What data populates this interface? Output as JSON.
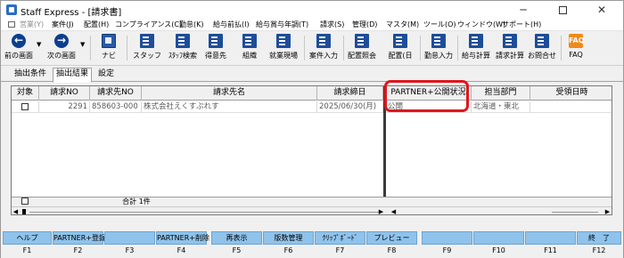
{
  "window": {
    "title": "Staff Express - [請求書]",
    "minimize": "─",
    "close": "✕"
  },
  "menu": [
    {
      "label": "営業(Y)",
      "disabled": true
    },
    {
      "label": "案件(J)"
    },
    {
      "label": "配置(H)"
    },
    {
      "label": "コンプライアンス(C)"
    },
    {
      "label": "勤怠(K)"
    },
    {
      "label": "給与前払(I)"
    },
    {
      "label": "給与賞与年調(T)"
    },
    {
      "label": "請求(S)"
    },
    {
      "label": "管理(D)"
    },
    {
      "label": "マスタ(M)"
    },
    {
      "label": "ツール(O)"
    },
    {
      "label": "ウィンドウ(W)"
    },
    {
      "label": "サポート(H)"
    }
  ],
  "toolbar": {
    "back": "前の画面",
    "forward": "次の画面",
    "navi": "ナビ",
    "staff": "スタッフ",
    "staff_search": "ｽﾀｯﾌ検索",
    "client": "得意先",
    "org": "組織",
    "site": "就業現場",
    "job_entry": "案件入力",
    "assign_view": "配置照会",
    "assign_day": "配置(日",
    "attendance": "勤怠入力",
    "payroll": "給与計算",
    "billing": "請求計算",
    "contact": "お問合せ",
    "faq": "FAQ",
    "faq_icon": "FAQ"
  },
  "tabs": [
    "抽出条件",
    "抽出結果",
    "設定"
  ],
  "grid": {
    "headers": [
      "対象",
      "請求NO",
      "請求先NO",
      "請求先名",
      "請求締日",
      "PARTNER+公開状況",
      "担当部門",
      "受領日時"
    ],
    "rows": [
      {
        "target": "",
        "billing_no": "2291",
        "client_no": "858603-000",
        "client_name": "株式会社えくすぷれす",
        "closing_date": "2025/06/30(月)",
        "partner_status": "公開",
        "dept": "北海道・東北",
        "received": ""
      }
    ],
    "total_label": "合計",
    "total_count": "1件"
  },
  "function_keys": [
    {
      "key": "F1",
      "label": "ヘルプ"
    },
    {
      "key": "F2",
      "label": "PARTNER+登録"
    },
    {
      "key": "F3",
      "label": ""
    },
    {
      "key": "F4",
      "label": "PARTNER+削除"
    },
    {
      "key": "F5",
      "label": "再表示"
    },
    {
      "key": "F6",
      "label": "版数管理"
    },
    {
      "key": "F7",
      "label": "ｸﾘｯﾌﾟﾎﾞｰﾄﾞ"
    },
    {
      "key": "F8",
      "label": "プレビュー"
    },
    {
      "key": "F9",
      "label": ""
    },
    {
      "key": "F10",
      "label": ""
    },
    {
      "key": "F11",
      "label": ""
    },
    {
      "key": "F12",
      "label": "終　了"
    }
  ],
  "colors": {
    "fkey": "#8fc3ec",
    "highlight": "#e0161c",
    "icon_blue": "#0b3f8f",
    "faq_orange": "#f08a1c"
  }
}
